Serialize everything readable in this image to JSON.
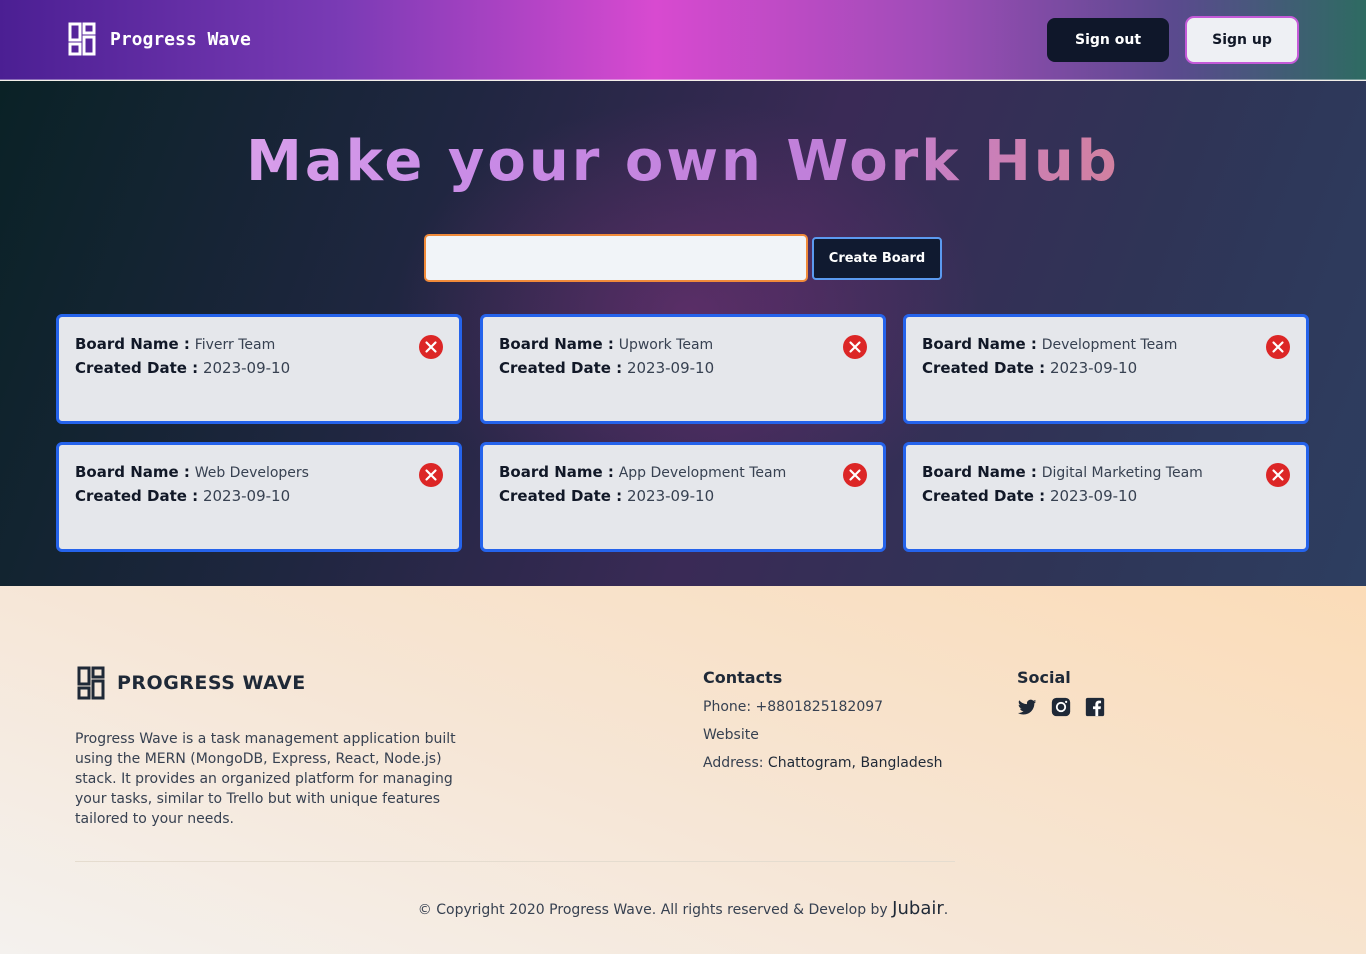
{
  "header": {
    "brand": "Progress Wave",
    "signout_label": "Sign out",
    "signup_label": "Sign up"
  },
  "hero": {
    "title": "Make your own Work Hub",
    "input_value": "",
    "create_label": "Create Board"
  },
  "board_labels": {
    "name_label": "Board Name :",
    "date_label": "Created Date :"
  },
  "boards": [
    {
      "name": "Fiverr Team",
      "date": "2023-09-10"
    },
    {
      "name": "Upwork Team",
      "date": "2023-09-10"
    },
    {
      "name": "Development Team",
      "date": "2023-09-10"
    },
    {
      "name": "Web Developers",
      "date": "2023-09-10"
    },
    {
      "name": "App Development Team",
      "date": "2023-09-10"
    },
    {
      "name": "Digital Marketing Team",
      "date": "2023-09-10"
    }
  ],
  "footer": {
    "brand": "PROGRESS WAVE",
    "description": "Progress Wave is a task management application built using the MERN (MongoDB, Express, React, Node.js) stack. It provides an organized platform for managing your tasks, similar to Trello but with unique features tailored to your needs.",
    "contacts_title": "Contacts",
    "phone": "Phone: +8801825182097",
    "website": "Website",
    "address_label": "Address: ",
    "address": "Chattogram, Bangladesh",
    "social_title": "Social",
    "social_icons": [
      "twitter-icon",
      "instagram-icon",
      "facebook-icon"
    ],
    "copyright": "© Copyright 2020 Progress Wave. All rights reserved & Develop by ",
    "author": "Jubair",
    "copyright_end": "."
  },
  "colors": {
    "card_border": "#2563eb",
    "close_button": "#dc2626",
    "input_border": "#f08a3a",
    "dark_button": "#0f172a"
  }
}
